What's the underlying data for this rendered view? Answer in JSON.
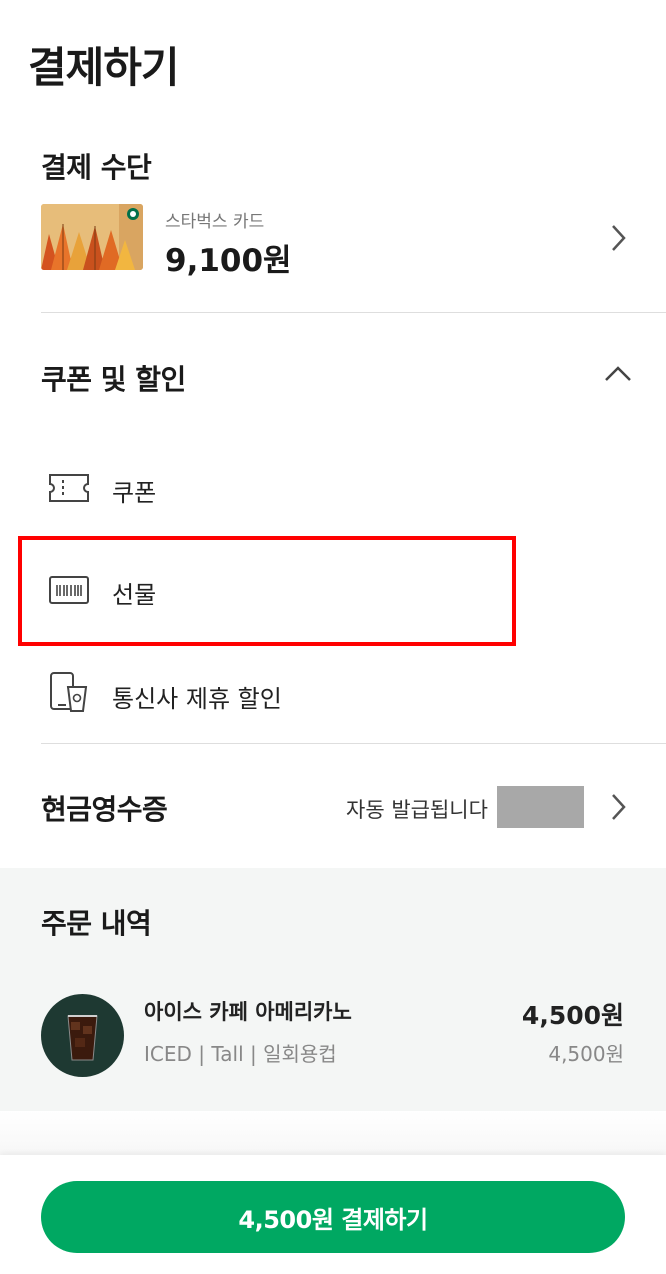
{
  "page": {
    "title": "결제하기"
  },
  "payment_method": {
    "title": "결제 수단",
    "card_name": "스타벅스 카드",
    "balance": "9,100원"
  },
  "coupon_discount": {
    "title": "쿠폰 및 할인",
    "items": [
      {
        "label": "쿠폰",
        "icon": "ticket-icon"
      },
      {
        "label": "선물",
        "icon": "gift-card-icon"
      },
      {
        "label": "통신사 제휴 할인",
        "icon": "phone-cup-icon"
      }
    ]
  },
  "cash_receipt": {
    "title": "현금영수증",
    "status": "자동 발급됩니다"
  },
  "order_history": {
    "title": "주문 내역",
    "items": [
      {
        "name": "아이스 카페 아메리카노",
        "options": "ICED | Tall | 일회용컵",
        "price": "4,500원",
        "unit_price": "4,500원"
      }
    ]
  },
  "pay_button": {
    "label": "4,500원 결제하기"
  },
  "colors": {
    "brand_green": "#00a862",
    "highlight": "#ff0000"
  }
}
